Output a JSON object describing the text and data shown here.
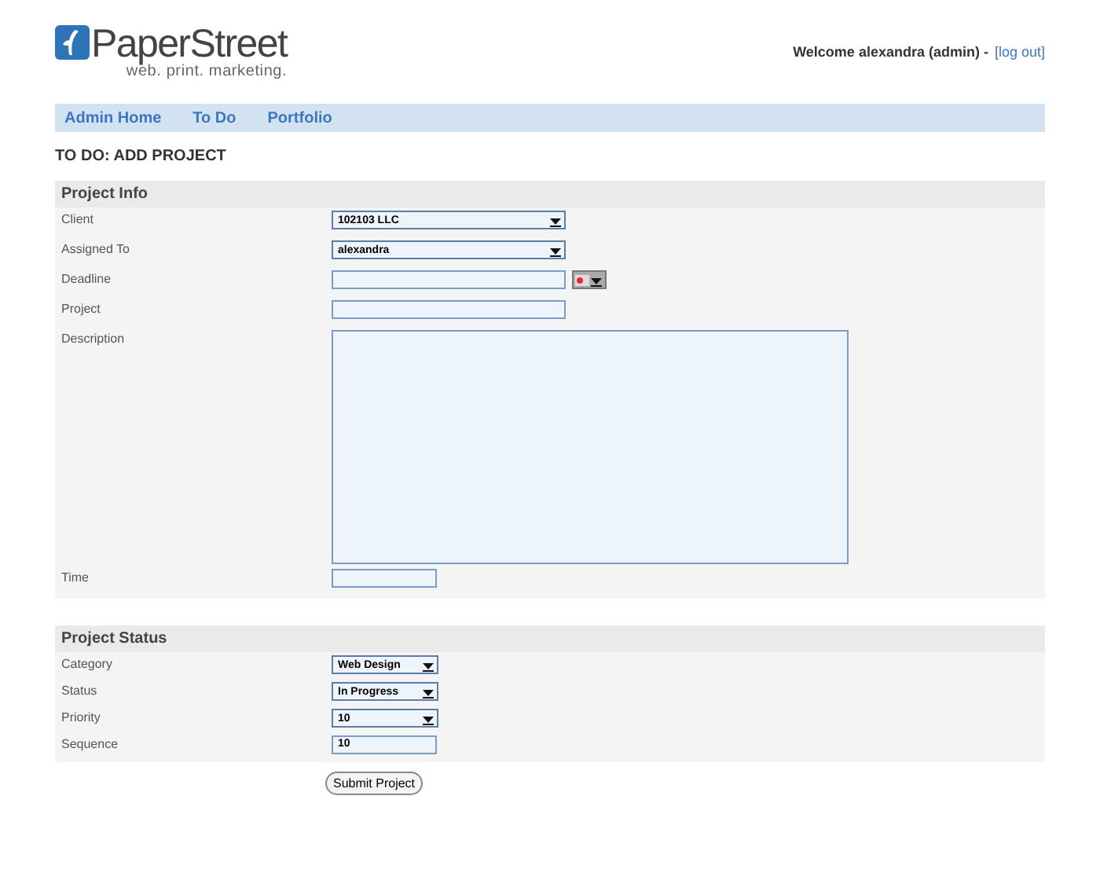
{
  "logo": {
    "name": "PaperStreet",
    "tagline": "web. print. marketing."
  },
  "user_bar": {
    "welcome": "Welcome alexandra (admin) -",
    "logout": "[log out]"
  },
  "nav": [
    {
      "label": "Admin Home"
    },
    {
      "label": "To Do"
    },
    {
      "label": "Portfolio"
    }
  ],
  "page_title": "TO DO: ADD PROJECT",
  "sections": [
    {
      "title": "Project Info",
      "fields": [
        {
          "label": "Client",
          "kind": "select",
          "value": "102103 LLC"
        },
        {
          "label": "Assigned To",
          "kind": "select",
          "value": "alexandra"
        },
        {
          "label": "Deadline",
          "kind": "date"
        },
        {
          "label": "Project",
          "kind": "text"
        },
        {
          "label": "Description",
          "kind": "textarea"
        },
        {
          "label": "Time",
          "kind": "shorttext"
        }
      ]
    },
    {
      "title": "Project Status",
      "fields": [
        {
          "label": "Category",
          "kind": "select",
          "value": "Web Design"
        },
        {
          "label": "Status",
          "kind": "select",
          "value": "In Progress"
        },
        {
          "label": "Priority",
          "kind": "select",
          "value": "10"
        },
        {
          "label": "Sequence",
          "kind": "shorttext",
          "value": "10"
        }
      ]
    }
  ],
  "submit": "Submit Project"
}
